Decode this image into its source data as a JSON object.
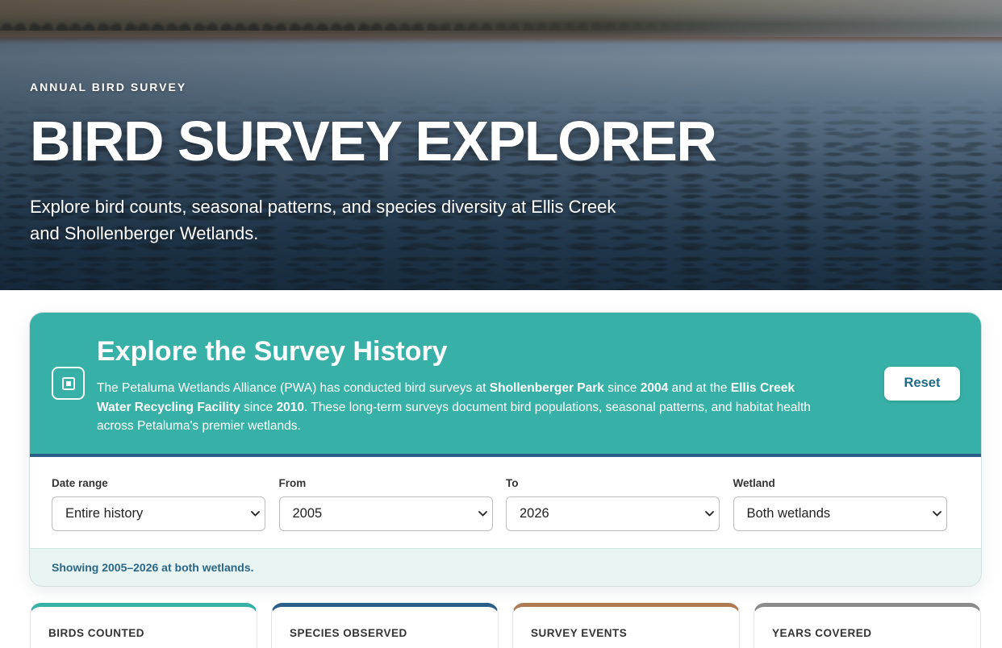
{
  "hero": {
    "eyebrow": "ANNUAL BIRD SURVEY",
    "title": "BIRD SURVEY EXPLORER",
    "subtitle": "Explore bird counts, seasonal patterns, and species diversity at Ellis Creek and Shollenberger Wetlands."
  },
  "intro": {
    "icon": "square-dot-icon",
    "title": "Explore the Survey History",
    "text_1": "The Petaluma Wetlands Alliance (PWA) has conducted bird surveys at ",
    "site_1": "Shollenberger Park",
    "text_2": " since ",
    "year_1": "2004",
    "text_3": " and at the ",
    "site_2": "Ellis Creek Water Recycling Facility",
    "text_4": " since ",
    "year_2": "2010",
    "text_5": ". These long-term surveys document bird populations, seasonal patterns, and habitat health across Petaluma's premier wetlands.",
    "reset_label": "Reset"
  },
  "filters": {
    "chevron_icon": "chevron-down-icon",
    "date_range": {
      "label": "Date range",
      "value": "Entire history"
    },
    "from": {
      "label": "From",
      "value": "2005"
    },
    "to": {
      "label": "To",
      "value": "2026"
    },
    "wetland": {
      "label": "Wetland",
      "value": "Both wetlands"
    }
  },
  "status": "Showing 2005–2026 at both wetlands.",
  "stats": [
    {
      "label": "BIRDS COUNTED",
      "accent": "#37b1a7"
    },
    {
      "label": "SPECIES OBSERVED",
      "accent": "#2b5f8a"
    },
    {
      "label": "SURVEY EVENTS",
      "accent": "#b07b52"
    },
    {
      "label": "YEARS COVERED",
      "accent": "#8b8b8b"
    }
  ],
  "colors": {
    "teal": "#37b1a7",
    "navy": "#2b5f8a",
    "status_background": "#e8f4f2",
    "status_text": "#2a6687",
    "reset_text": "#1f6b86"
  }
}
